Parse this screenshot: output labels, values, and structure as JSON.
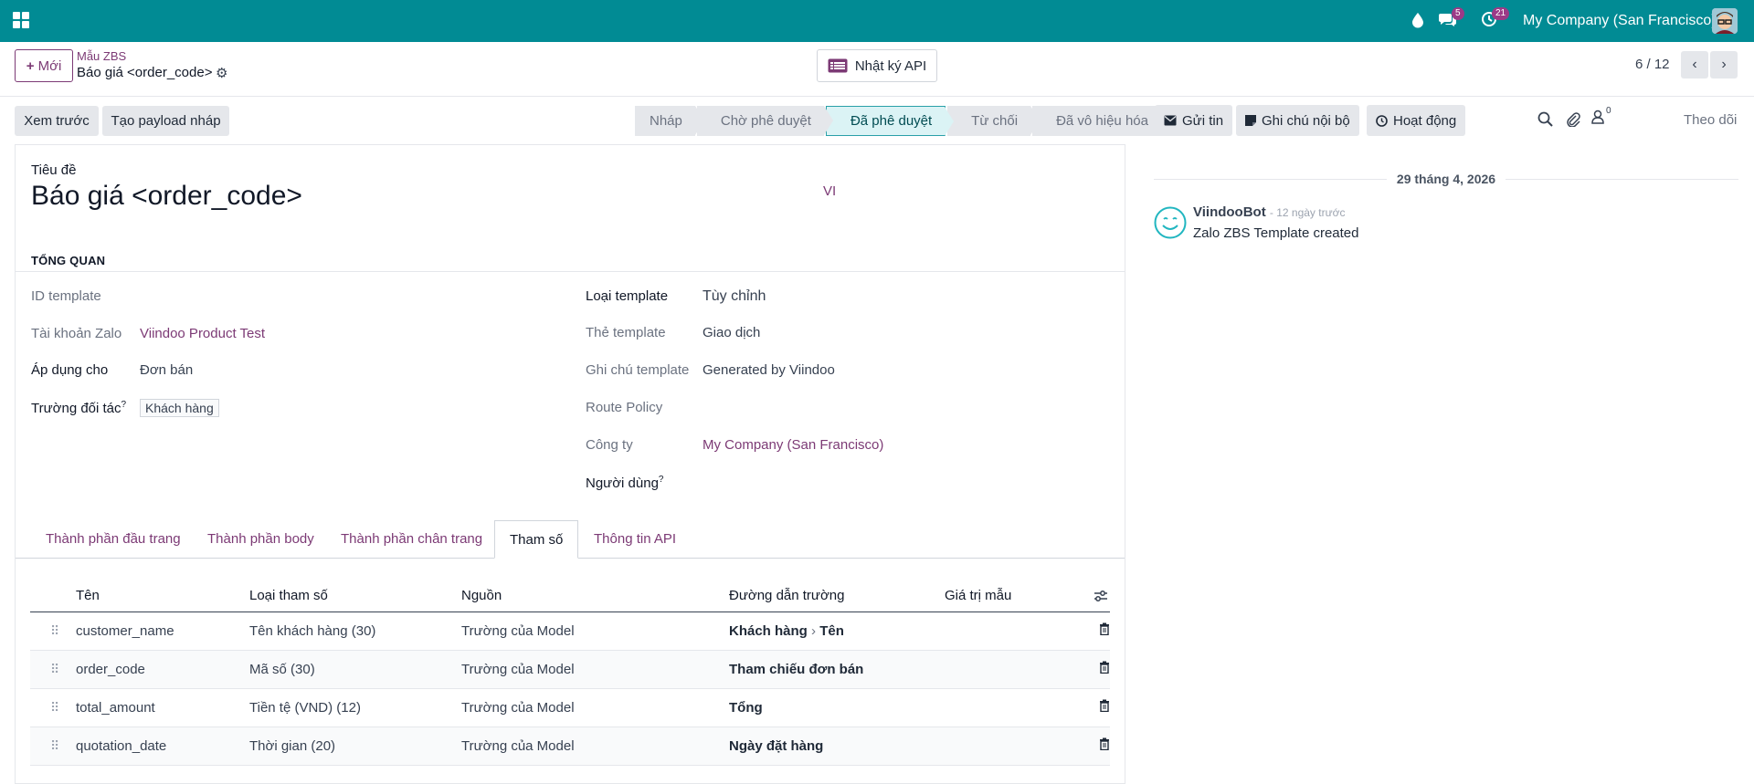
{
  "navbar": {
    "company": "My Company (San Francisco)",
    "messages_badge": "5",
    "activities_badge": "21",
    "brand_color": "#018b94"
  },
  "control_panel": {
    "new_button": "Mới",
    "breadcrumb_parent": "Mẫu ZBS",
    "breadcrumb_current": "Báo giá <order_code>",
    "api_log_button": "Nhật ký API",
    "pager": "6 / 12"
  },
  "form_header": {
    "preview_button": "Xem trước",
    "draft_payload_button": "Tạo payload nháp",
    "stages": [
      {
        "label": "Nháp",
        "active": false
      },
      {
        "label": "Chờ phê duyệt",
        "active": false
      },
      {
        "label": "Đã phê duyệt",
        "active": true
      },
      {
        "label": "Từ chối",
        "active": false
      },
      {
        "label": "Đã vô hiệu hóa",
        "active": false
      }
    ]
  },
  "form": {
    "title_label": "Tiêu đề",
    "title": "Báo giá <order_code>",
    "lang": "VI",
    "section": "TỔNG QUAN",
    "left_fields": [
      {
        "label": "ID template",
        "value": ""
      },
      {
        "label": "Tài khoản Zalo",
        "value": "Viindoo Product Test"
      },
      {
        "label": "Áp dụng cho",
        "value": "Đơn bán"
      },
      {
        "label": "Trường đối tác",
        "value": "Khách hàng"
      }
    ],
    "right_fields": [
      {
        "label": "Loại template",
        "value": "Tùy chỉnh"
      },
      {
        "label": "Thẻ template",
        "value": "Giao dịch"
      },
      {
        "label": "Ghi chú template",
        "value": "Generated by Viindoo"
      },
      {
        "label": "Route Policy",
        "value": ""
      },
      {
        "label": "Công ty",
        "value": "My Company (San Francisco)"
      },
      {
        "label": "Người dùng",
        "value": ""
      }
    ],
    "help_mark": "?"
  },
  "tabs": [
    "Thành phần đầu trang",
    "Thành phần body",
    "Thành phần chân trang",
    "Tham số",
    "Thông tin API"
  ],
  "table": {
    "headers": [
      "Tên",
      "Loại tham số",
      "Nguồn",
      "Đường dẫn trường",
      "Giá trị mẫu"
    ],
    "rows": [
      {
        "name": "customer_name",
        "type": "Tên khách hàng (30)",
        "source": "Trường của Model",
        "path_a": "Khách hàng",
        "path_b": "Tên",
        "sample": ""
      },
      {
        "name": "order_code",
        "type": "Mã số (30)",
        "source": "Trường của Model",
        "path_a": "Tham chiếu đơn bán",
        "path_b": "",
        "sample": ""
      },
      {
        "name": "total_amount",
        "type": "Tiền tệ (VND) (12)",
        "source": "Trường của Model",
        "path_a": "Tổng",
        "path_b": "",
        "sample": ""
      },
      {
        "name": "quotation_date",
        "type": "Thời gian (20)",
        "source": "Trường của Model",
        "path_a": "Ngày đặt hàng",
        "path_b": "",
        "sample": ""
      }
    ]
  },
  "chatter": {
    "send_message": "Gửi tin",
    "log_note": "Ghi chú nội bộ",
    "activities": "Hoạt động",
    "followers_count": "0",
    "follow": "Theo dõi",
    "date": "29 tháng 4, 2026",
    "author": "ViindooBot",
    "time": "- 12 ngày trước",
    "body": "Zalo ZBS Template created"
  }
}
